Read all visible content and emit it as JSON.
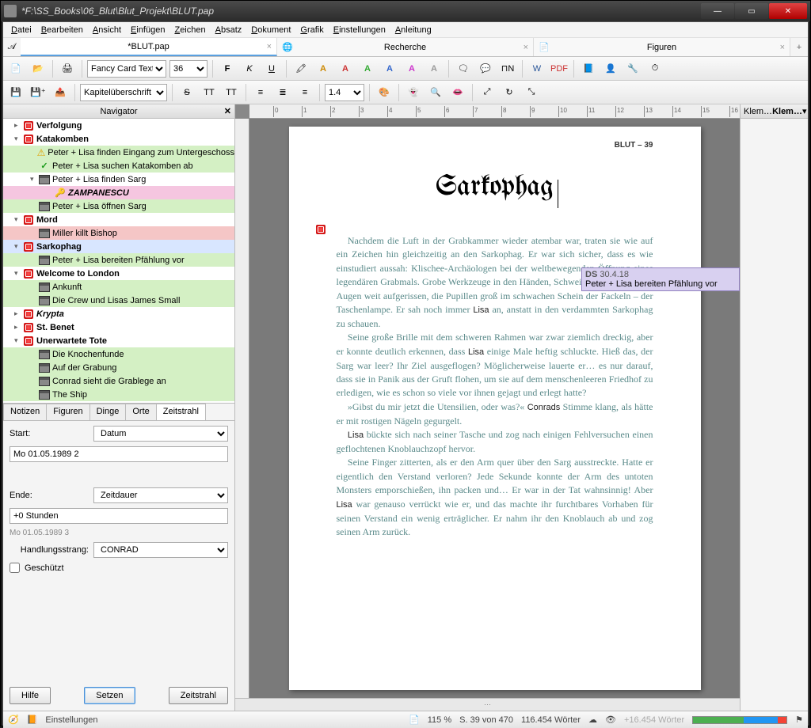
{
  "window_title": "*F:\\SS_Books\\06_Blut\\Blut_Projekt\\BLUT.pap",
  "menu": [
    "Datei",
    "Bearbeiten",
    "Ansicht",
    "Einfügen",
    "Zeichen",
    "Absatz",
    "Dokument",
    "Grafik",
    "Einstellungen",
    "Anleitung"
  ],
  "tabs": [
    {
      "label": "*BLUT.pap",
      "active": true
    },
    {
      "label": "Recherche",
      "active": false
    },
    {
      "label": "Figuren",
      "active": false
    }
  ],
  "toolbar1": {
    "font_family": "Fancy Card Text",
    "font_size": "36"
  },
  "toolbar2": {
    "style_select": "Kapitelüberschrift art",
    "line_spacing": "1.4"
  },
  "navigator": {
    "title": "Navigator",
    "items": [
      {
        "type": "chapter",
        "label": "Verfolgung",
        "icon": "stop",
        "level": 0,
        "bold": true,
        "arrow": "▸"
      },
      {
        "type": "chapter",
        "label": "Katakomben",
        "icon": "stop",
        "level": 0,
        "bold": true,
        "arrow": "▾"
      },
      {
        "type": "scene",
        "label": "Peter + Lisa finden Eingang zum Untergeschoss",
        "icon": "warn",
        "level": 1,
        "bg": "green",
        "arrow": ""
      },
      {
        "type": "scene",
        "label": "Peter + Lisa suchen Katakomben ab",
        "icon": "check",
        "level": 1,
        "bg": "green",
        "arrow": ""
      },
      {
        "type": "scene",
        "label": "Peter + Lisa finden Sarg",
        "icon": "clap",
        "level": 1,
        "bg": "",
        "arrow": "▾"
      },
      {
        "type": "item",
        "label": "ZAMPANESCU",
        "icon": "key",
        "level": 2,
        "bg": "pink",
        "arrow": "",
        "italic": true,
        "bolditalic": true
      },
      {
        "type": "scene",
        "label": "Peter + Lisa öffnen Sarg",
        "icon": "clap",
        "level": 1,
        "bg": "green",
        "arrow": ""
      },
      {
        "type": "chapter",
        "label": "Mord",
        "icon": "stop",
        "level": 0,
        "bold": true,
        "arrow": "▾"
      },
      {
        "type": "scene",
        "label": "Miller killt Bishop",
        "icon": "clap",
        "level": 1,
        "bg": "red",
        "arrow": ""
      },
      {
        "type": "chapter",
        "label": "Sarkophag",
        "icon": "stop",
        "level": 0,
        "bold": true,
        "arrow": "▾",
        "sel": true
      },
      {
        "type": "scene",
        "label": "Peter + Lisa bereiten Pfählung vor",
        "icon": "clap",
        "level": 1,
        "bg": "green",
        "arrow": ""
      },
      {
        "type": "chapter",
        "label": "Welcome to London",
        "icon": "stop",
        "level": 0,
        "bold": true,
        "arrow": "▾"
      },
      {
        "type": "scene",
        "label": "Ankunft",
        "icon": "clap",
        "level": 1,
        "bg": "green",
        "arrow": ""
      },
      {
        "type": "scene",
        "label": "Die Crew und Lisas James Small",
        "icon": "clap",
        "level": 1,
        "bg": "green",
        "arrow": ""
      },
      {
        "type": "chapter",
        "label": "Krypta",
        "icon": "stop",
        "level": 0,
        "bold": true,
        "italic": true,
        "arrow": "▸"
      },
      {
        "type": "chapter",
        "label": "St. Benet",
        "icon": "stop",
        "level": 0,
        "bold": true,
        "arrow": "▸"
      },
      {
        "type": "chapter",
        "label": "Unerwartete Tote",
        "icon": "stop",
        "level": 0,
        "bold": true,
        "arrow": "▾"
      },
      {
        "type": "scene",
        "label": "Die Knochenfunde",
        "icon": "clap",
        "level": 1,
        "bg": "green",
        "arrow": ""
      },
      {
        "type": "scene",
        "label": "Auf der Grabung",
        "icon": "clap",
        "level": 1,
        "bg": "green",
        "arrow": ""
      },
      {
        "type": "scene",
        "label": "Conrad sieht die Grablege an",
        "icon": "clap",
        "level": 1,
        "bg": "green",
        "arrow": ""
      },
      {
        "type": "scene",
        "label": "The Ship",
        "icon": "clap",
        "level": 1,
        "bg": "green",
        "arrow": ""
      }
    ]
  },
  "detail_tabs": [
    "Notizen",
    "Figuren",
    "Dinge",
    "Orte",
    "Zeitstrahl"
  ],
  "detail_active": "Zeitstrahl",
  "detail": {
    "start_label": "Start:",
    "start_mode": "Datum",
    "start_value": "Mo 01.05.1989 2",
    "end_label": "Ende:",
    "end_mode": "Zeitdauer",
    "end_value": "+0 Stunden",
    "end_date": "Mo 01.05.1989 3",
    "strand_label": "Handlungsstrang:",
    "strand_value": "CONRAD",
    "protected_label": "Geschützt"
  },
  "buttons": {
    "help": "Hilfe",
    "set": "Setzen",
    "timeline": "Zeitstrahl"
  },
  "page": {
    "header": "BLUT – 39",
    "chapter_title": "Sarkophag",
    "paragraphs": [
      "Nachdem die Luft in der Grabkammer wieder atembar war, traten sie wie auf ein Zeichen hin gleichzeitig an den Sarkophag. Er war sich sicher, dass es wie einstudiert aussah: Klischee-Archäologen bei der weltbewegenden Öffnung eines legendären Grabmals. Grobe Werkzeuge in den Händen, Schweiß auf der Stirn, die Augen weit aufgerissen, die Pupillen groß im schwachen Schein der Fackeln – der Taschenlampe. Er sah noch immer |Lisa| an, anstatt in den verdammten Sarkophag zu schauen.",
      "Seine große Brille mit dem schweren Rahmen war zwar ziemlich dreckig, aber er konnte deutlich erkennen, dass |Lisa| einige Male heftig schluckte. Hieß das, der Sarg war leer? Ihr Ziel ausgeflogen? Möglicherweise lauerte er… es nur darauf, dass sie in Panik aus der Gruft flohen, um sie auf dem menschenleeren Friedhof zu erledigen, wie es schon so viele vor ihnen gejagt und erlegt hatte?",
      "»Gibst du mir jetzt die Utensilien, oder was?« |Conrads| Stimme klang, als hätte er mit rostigen Nägeln gegurgelt.",
      "|Lisa| bückte sich nach seiner Tasche und zog nach einigen Fehlversuchen einen geflochtenen Knoblauchzopf hervor.",
      "Seine Finger zitterten, als er den Arm quer über den Sarg ausstreckte. Hatte er eigentlich den Verstand verloren? Jede Sekunde konnte der Arm des untoten Monsters emporschießen, ihn packen und… Er war in der Tat wahnsinnig! Aber |Lisa| war genauso verrückt wie er, und das machte ihr furchtbares Vorhaben für seinen Verstand ein wenig erträglicher. Er nahm ihr den Knoblauch ab und zog seinen Arm zurück."
    ]
  },
  "annotation": {
    "meta": "DS 30.4.18",
    "text": "Peter + Lisa bereiten Pfählung vor"
  },
  "rightpane": {
    "tab1": "Klem…",
    "tab2": "Klem…"
  },
  "status": {
    "settings": "Einstellungen",
    "zoom": "115 %",
    "page": "S. 39 von 470",
    "words": "116.454 Wörter",
    "words2": "+16.454 Wörter"
  }
}
